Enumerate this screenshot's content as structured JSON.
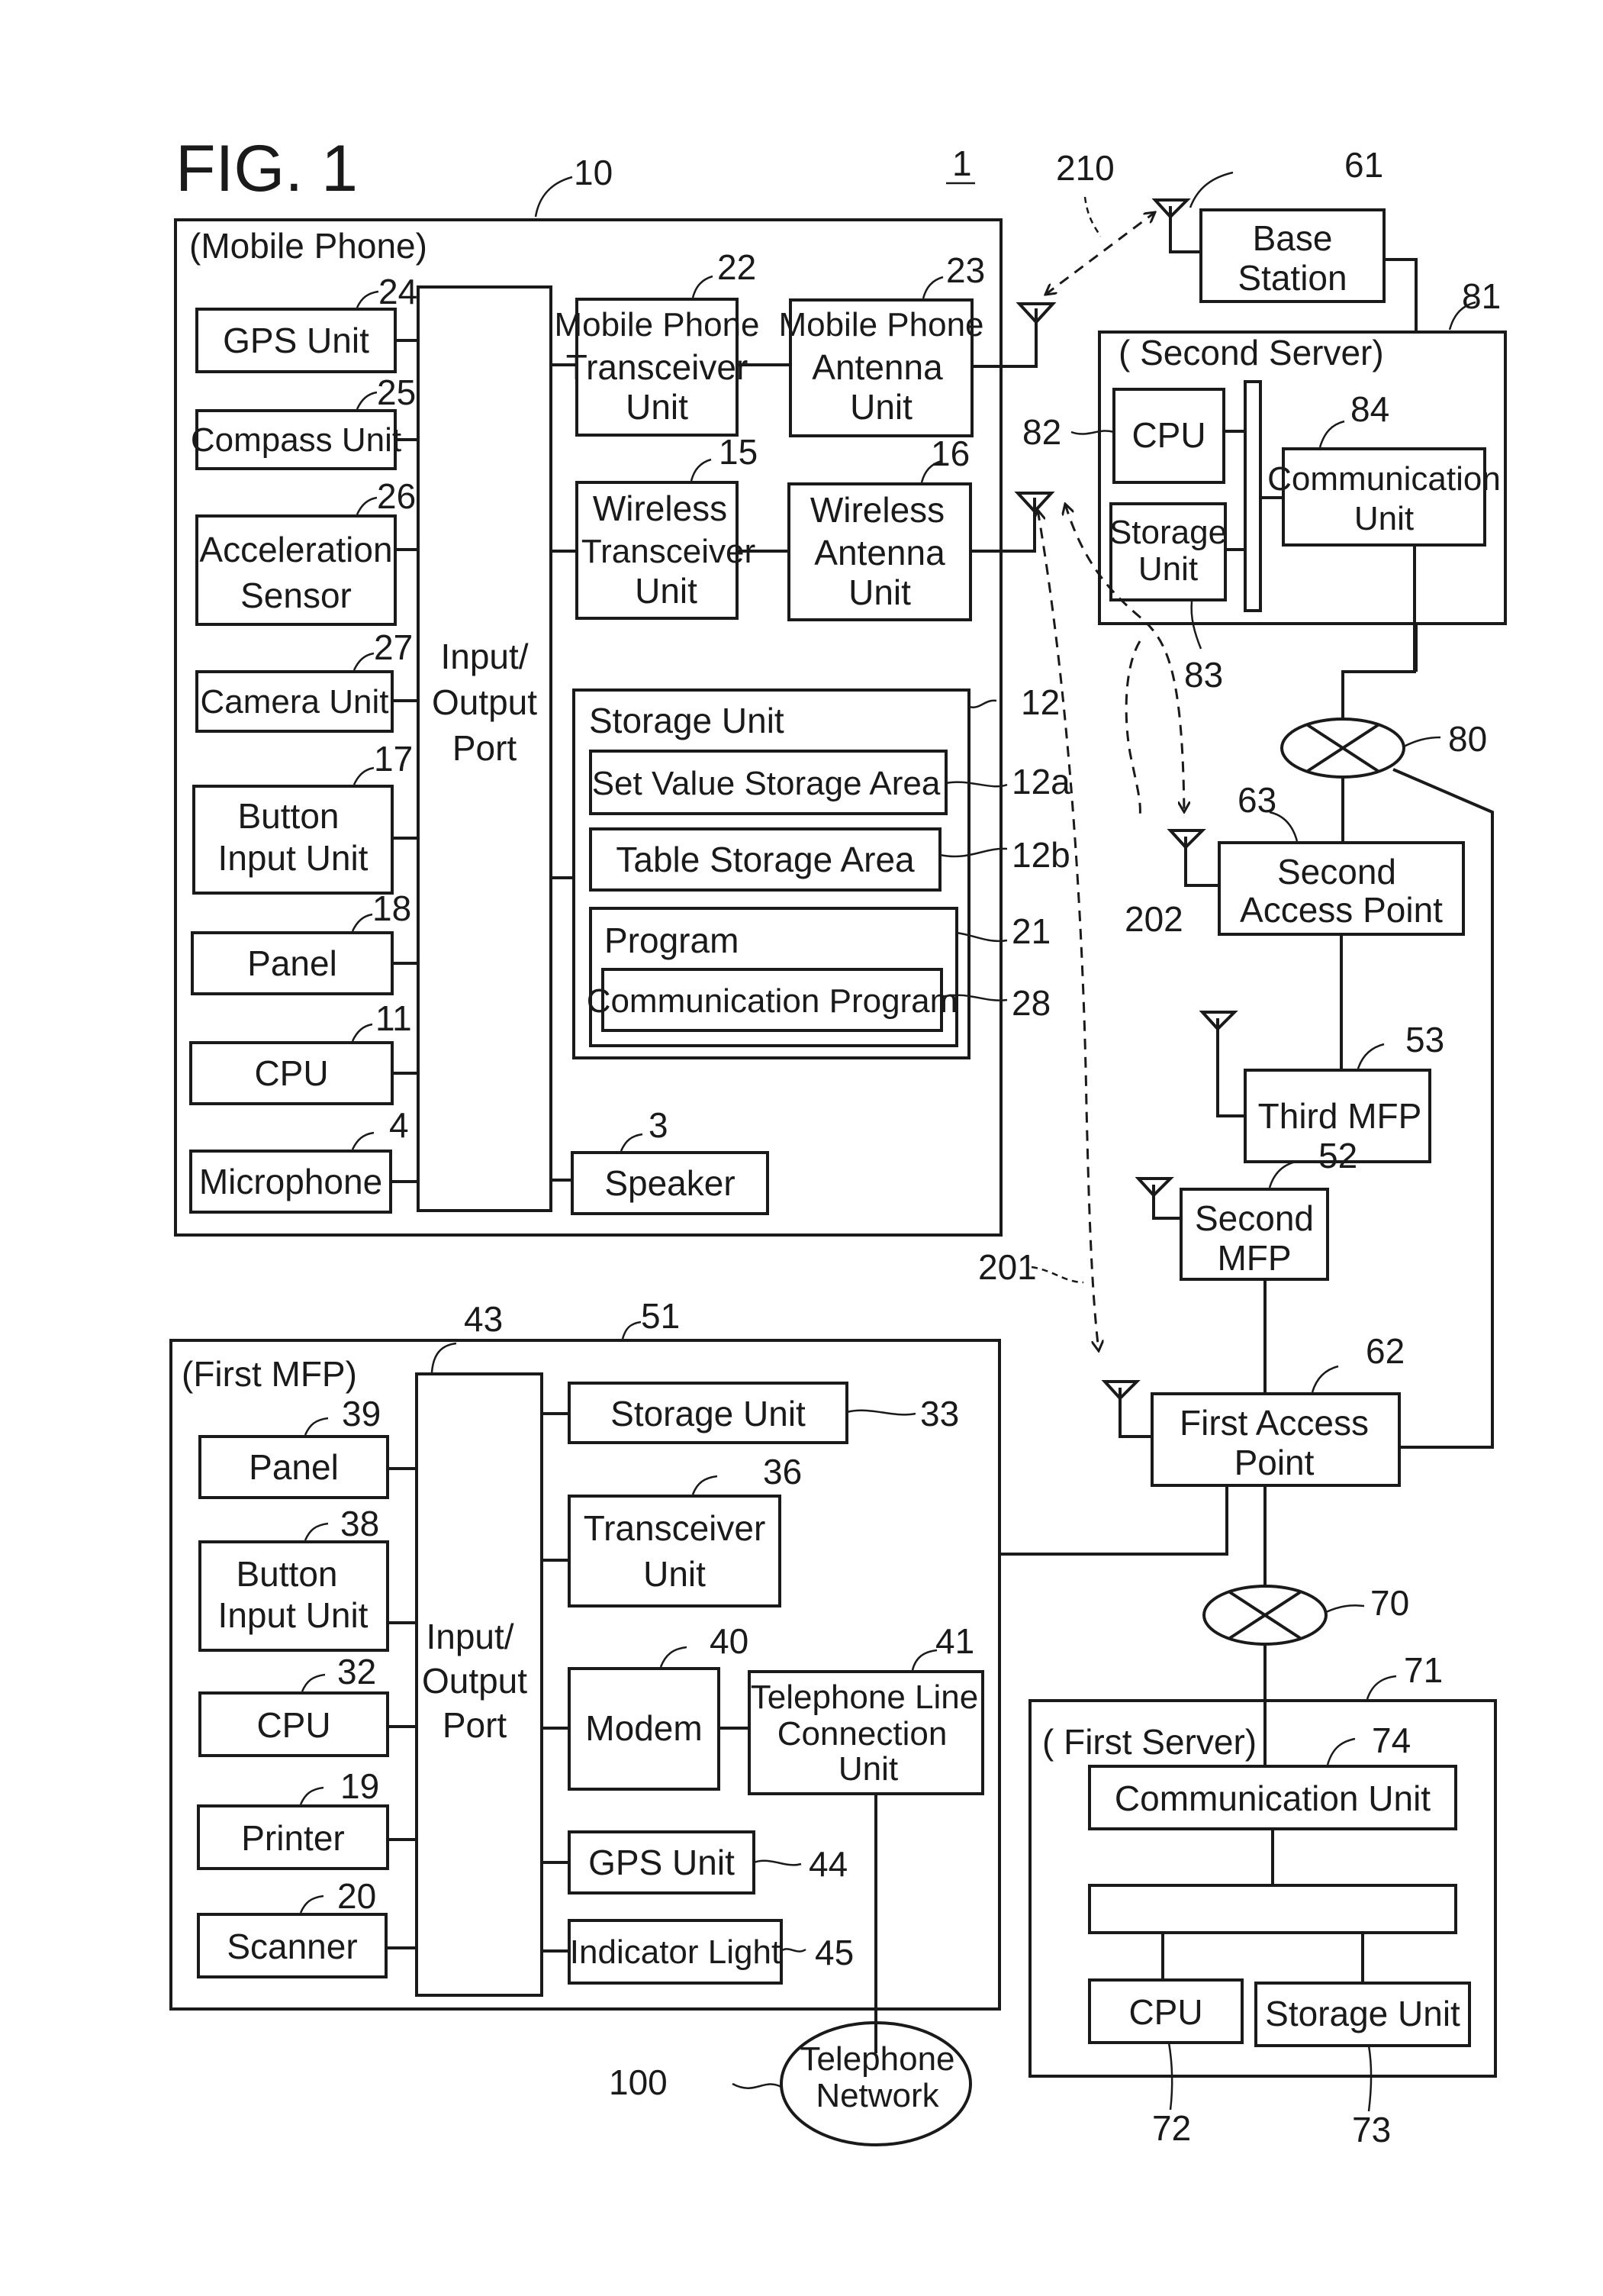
{
  "figure": {
    "title": "FIG. 1",
    "system_ref": "1"
  },
  "mobile_phone": {
    "title": "(Mobile Phone)",
    "ref": "10",
    "io_port": {
      "line1": "Input/",
      "line2": "Output",
      "line3": "Port"
    },
    "gps": {
      "label": "GPS Unit",
      "ref": "24"
    },
    "compass": {
      "label": "Compass Unit",
      "ref": "25"
    },
    "accel": {
      "line1": "Acceleration",
      "line2": "Sensor",
      "ref": "26"
    },
    "camera": {
      "label": "Camera Unit",
      "ref": "27"
    },
    "button": {
      "line1": "Button",
      "line2": "Input Unit",
      "ref": "17"
    },
    "panel": {
      "label": "Panel",
      "ref": "18"
    },
    "cpu": {
      "label": "CPU",
      "ref": "11"
    },
    "microphone": {
      "label": "Microphone",
      "ref": "4"
    },
    "mp_transceiver": {
      "line1": "Mobile Phone",
      "line2": "Transceiver",
      "line3": "Unit",
      "ref": "22"
    },
    "mp_antenna": {
      "line1": "Mobile Phone",
      "line2": "Antenna",
      "line3": "Unit",
      "ref": "23"
    },
    "w_transceiver": {
      "line1": "Wireless",
      "line2": "Transceiver",
      "line3": "Unit",
      "ref": "15"
    },
    "w_antenna": {
      "line1": "Wireless",
      "line2": "Antenna",
      "line3": "Unit",
      "ref": "16"
    },
    "storage": {
      "label": "Storage Unit",
      "ref": "12"
    },
    "set_value": {
      "label": "Set Value Storage Area",
      "ref": "12a"
    },
    "table_storage": {
      "label": "Table Storage Area",
      "ref": "12b"
    },
    "program": {
      "label": "Program",
      "ref": "21"
    },
    "comm_program": {
      "label": "Communication Program",
      "ref": "28"
    },
    "speaker": {
      "label": "Speaker",
      "ref": "3"
    }
  },
  "base_station": {
    "line1": "Base",
    "line2": "Station",
    "ref": "61"
  },
  "second_server": {
    "title": "( Second Server)",
    "ref": "81",
    "cpu": {
      "label": "CPU",
      "ref": "82"
    },
    "storage": {
      "line1": "Storage",
      "line2": "Unit",
      "ref": "83"
    },
    "comm": {
      "line1": "Communication",
      "line2": "Unit",
      "ref": "84"
    }
  },
  "network_80": {
    "ref": "80"
  },
  "second_ap": {
    "line1": "Second",
    "line2": "Access Point",
    "ref": "63"
  },
  "third_mfp": {
    "label": "Third MFP",
    "ref": "53"
  },
  "second_mfp": {
    "line1": "Second",
    "line2": "MFP",
    "ref": "52"
  },
  "first_ap": {
    "line1": "First Access",
    "line2": "Point",
    "ref": "62"
  },
  "network_70": {
    "ref": "70"
  },
  "links": {
    "l210": "210",
    "l202": "202",
    "l201": "201"
  },
  "first_mfp": {
    "title": "(First MFP)",
    "ref": "51",
    "io_port": {
      "line1": "Input/",
      "line2": "Output",
      "line3": "Port",
      "ref": "43"
    },
    "panel": {
      "label": "Panel",
      "ref": "39"
    },
    "button": {
      "line1": "Button",
      "line2": "Input Unit",
      "ref": "38"
    },
    "cpu": {
      "label": "CPU",
      "ref": "32"
    },
    "printer": {
      "label": "Printer",
      "ref": "19"
    },
    "scanner": {
      "label": "Scanner",
      "ref": "20"
    },
    "storage": {
      "label": "Storage Unit",
      "ref": "33"
    },
    "transceiver": {
      "line1": "Transceiver",
      "line2": "Unit",
      "ref": "36"
    },
    "modem": {
      "label": "Modem",
      "ref": "40"
    },
    "tel_line": {
      "line1": "Telephone Line",
      "line2": "Connection",
      "line3": "Unit",
      "ref": "41"
    },
    "gps": {
      "label": "GPS Unit",
      "ref": "44"
    },
    "indicator": {
      "label": "Indicator Light",
      "ref": "45"
    }
  },
  "telephone_network": {
    "line1": "Telephone",
    "line2": "Network",
    "ref": "100"
  },
  "first_server": {
    "title": "( First Server)",
    "ref": "71",
    "comm": {
      "label": "Communication Unit",
      "ref": "74"
    },
    "cpu": {
      "label": "CPU",
      "ref": "72"
    },
    "storage": {
      "label": "Storage Unit",
      "ref": "73"
    }
  }
}
